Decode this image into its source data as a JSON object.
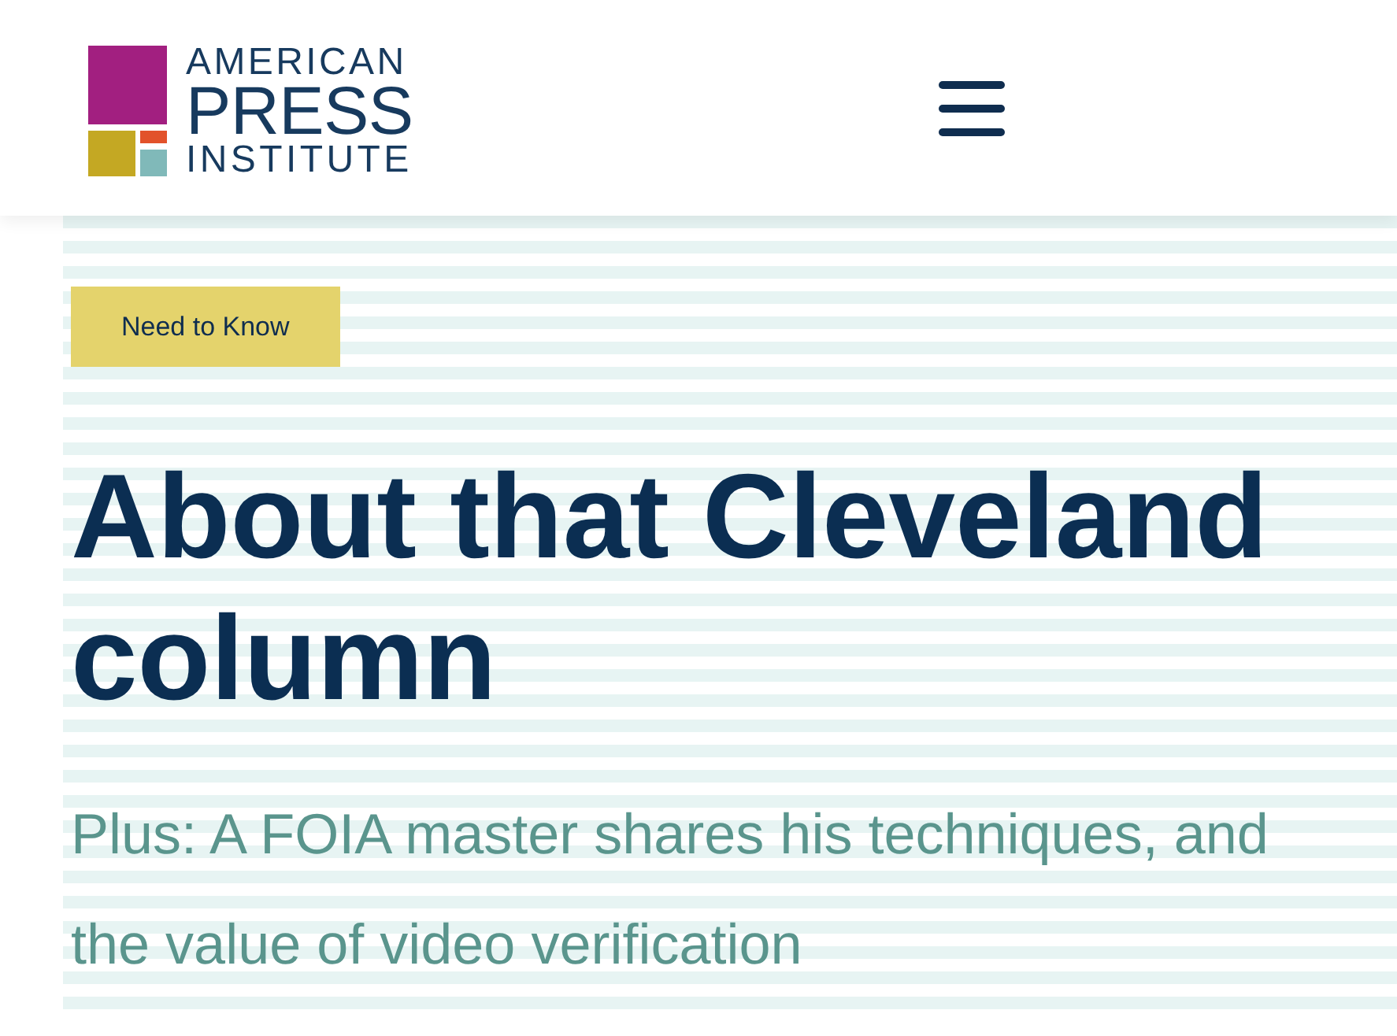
{
  "header": {
    "logo": {
      "lines": [
        "AMERICAN",
        "PRESS",
        "INSTITUTE"
      ]
    }
  },
  "article": {
    "tag": "Need to Know",
    "title": "About that Cleveland column",
    "subtitle": "Plus: A FOIA master shares his techniques, and the value of video verification"
  }
}
